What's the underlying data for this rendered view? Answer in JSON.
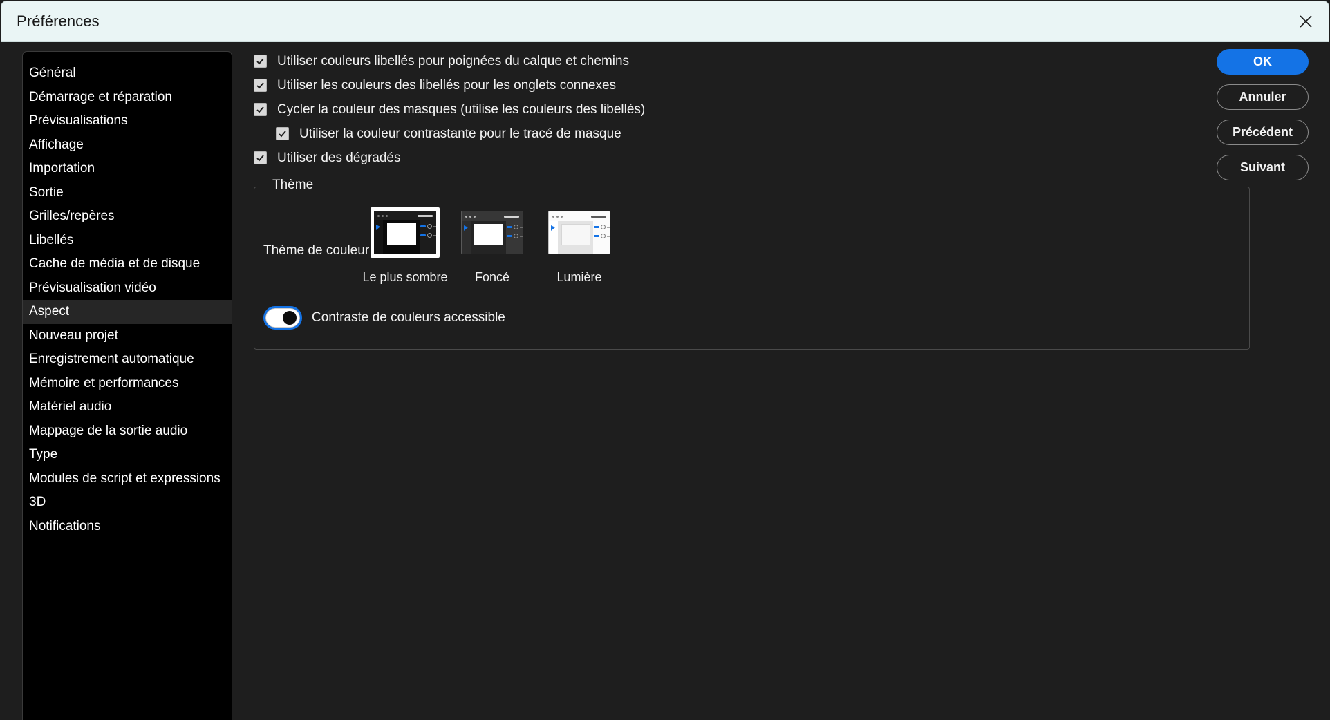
{
  "window": {
    "title": "Préférences",
    "close_icon": "close-icon"
  },
  "sidebar": {
    "items": [
      {
        "label": "Général",
        "selected": false
      },
      {
        "label": "Démarrage et réparation",
        "selected": false
      },
      {
        "label": "Prévisualisations",
        "selected": false
      },
      {
        "label": "Affichage",
        "selected": false
      },
      {
        "label": "Importation",
        "selected": false
      },
      {
        "label": "Sortie",
        "selected": false
      },
      {
        "label": "Grilles/repères",
        "selected": false
      },
      {
        "label": "Libellés",
        "selected": false
      },
      {
        "label": "Cache de média et de disque",
        "selected": false
      },
      {
        "label": "Prévisualisation vidéo",
        "selected": false
      },
      {
        "label": "Aspect",
        "selected": true
      },
      {
        "label": "Nouveau projet",
        "selected": false
      },
      {
        "label": "Enregistrement automatique",
        "selected": false
      },
      {
        "label": "Mémoire et performances",
        "selected": false
      },
      {
        "label": "Matériel audio",
        "selected": false
      },
      {
        "label": "Mappage de la sortie audio",
        "selected": false
      },
      {
        "label": "Type",
        "selected": false
      },
      {
        "label": "Modules de script et expressions",
        "selected": false
      },
      {
        "label": "3D",
        "selected": false
      },
      {
        "label": "Notifications",
        "selected": false
      }
    ]
  },
  "checkboxes": [
    {
      "label": "Utiliser couleurs libellés pour poignées du calque et chemins",
      "checked": true,
      "indent": false
    },
    {
      "label": "Utiliser les couleurs des libellés pour les onglets connexes",
      "checked": true,
      "indent": false
    },
    {
      "label": "Cycler la couleur des masques (utilise les couleurs des libellés)",
      "checked": true,
      "indent": false
    },
    {
      "label": "Utiliser la couleur contrastante pour le tracé de masque",
      "checked": true,
      "indent": true
    },
    {
      "label": "Utiliser des dégradés",
      "checked": true,
      "indent": false
    }
  ],
  "theme_group": {
    "legend": "Thème",
    "color_theme_label": "Thème de couleur",
    "themes": [
      {
        "caption": "Le plus sombre",
        "variant": "darkest",
        "selected": true
      },
      {
        "caption": "Foncé",
        "variant": "dark",
        "selected": false
      },
      {
        "caption": "Lumière",
        "variant": "light",
        "selected": false
      }
    ],
    "toggle": {
      "label": "Contraste de couleurs accessible",
      "on": true
    }
  },
  "buttons": [
    {
      "label": "OK",
      "style": "primary"
    },
    {
      "label": "Annuler",
      "style": "secondary"
    },
    {
      "label": "Précédent",
      "style": "secondary"
    },
    {
      "label": "Suivant",
      "style": "secondary"
    }
  ],
  "colors": {
    "accent": "#1473e6",
    "titlebar_bg": "#eaf5f5",
    "panel_bg": "#1e1e1e",
    "sidebar_bg": "#000000",
    "selected_row_bg": "#262626"
  }
}
